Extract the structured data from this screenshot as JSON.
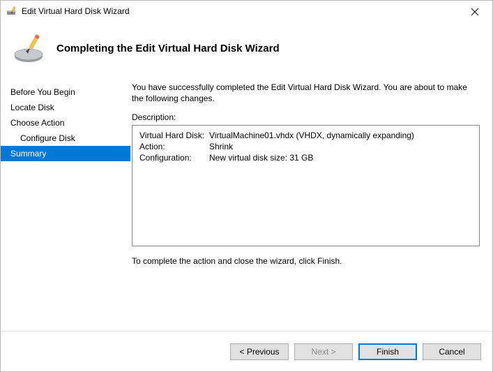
{
  "title": "Edit Virtual Hard Disk Wizard",
  "header": {
    "heading": "Completing the Edit Virtual Hard Disk Wizard"
  },
  "sidebar": {
    "items": [
      {
        "label": "Before You Begin",
        "sub": false,
        "selected": false
      },
      {
        "label": "Locate Disk",
        "sub": false,
        "selected": false
      },
      {
        "label": "Choose Action",
        "sub": false,
        "selected": false
      },
      {
        "label": "Configure Disk",
        "sub": true,
        "selected": false
      },
      {
        "label": "Summary",
        "sub": false,
        "selected": true
      }
    ]
  },
  "content": {
    "intro": "You have successfully completed the Edit Virtual Hard Disk Wizard. You are about to make the following changes.",
    "description_label": "Description:",
    "details": [
      {
        "key": "Virtual Hard Disk:",
        "value": "VirtualMachine01.vhdx (VHDX, dynamically expanding)"
      },
      {
        "key": "Action:",
        "value": "Shrink"
      },
      {
        "key": "Configuration:",
        "value": "New virtual disk size: 31 GB"
      }
    ],
    "closing": "To complete the action and close the wizard, click Finish."
  },
  "footer": {
    "previous": "< Previous",
    "next": "Next >",
    "finish": "Finish",
    "cancel": "Cancel"
  }
}
